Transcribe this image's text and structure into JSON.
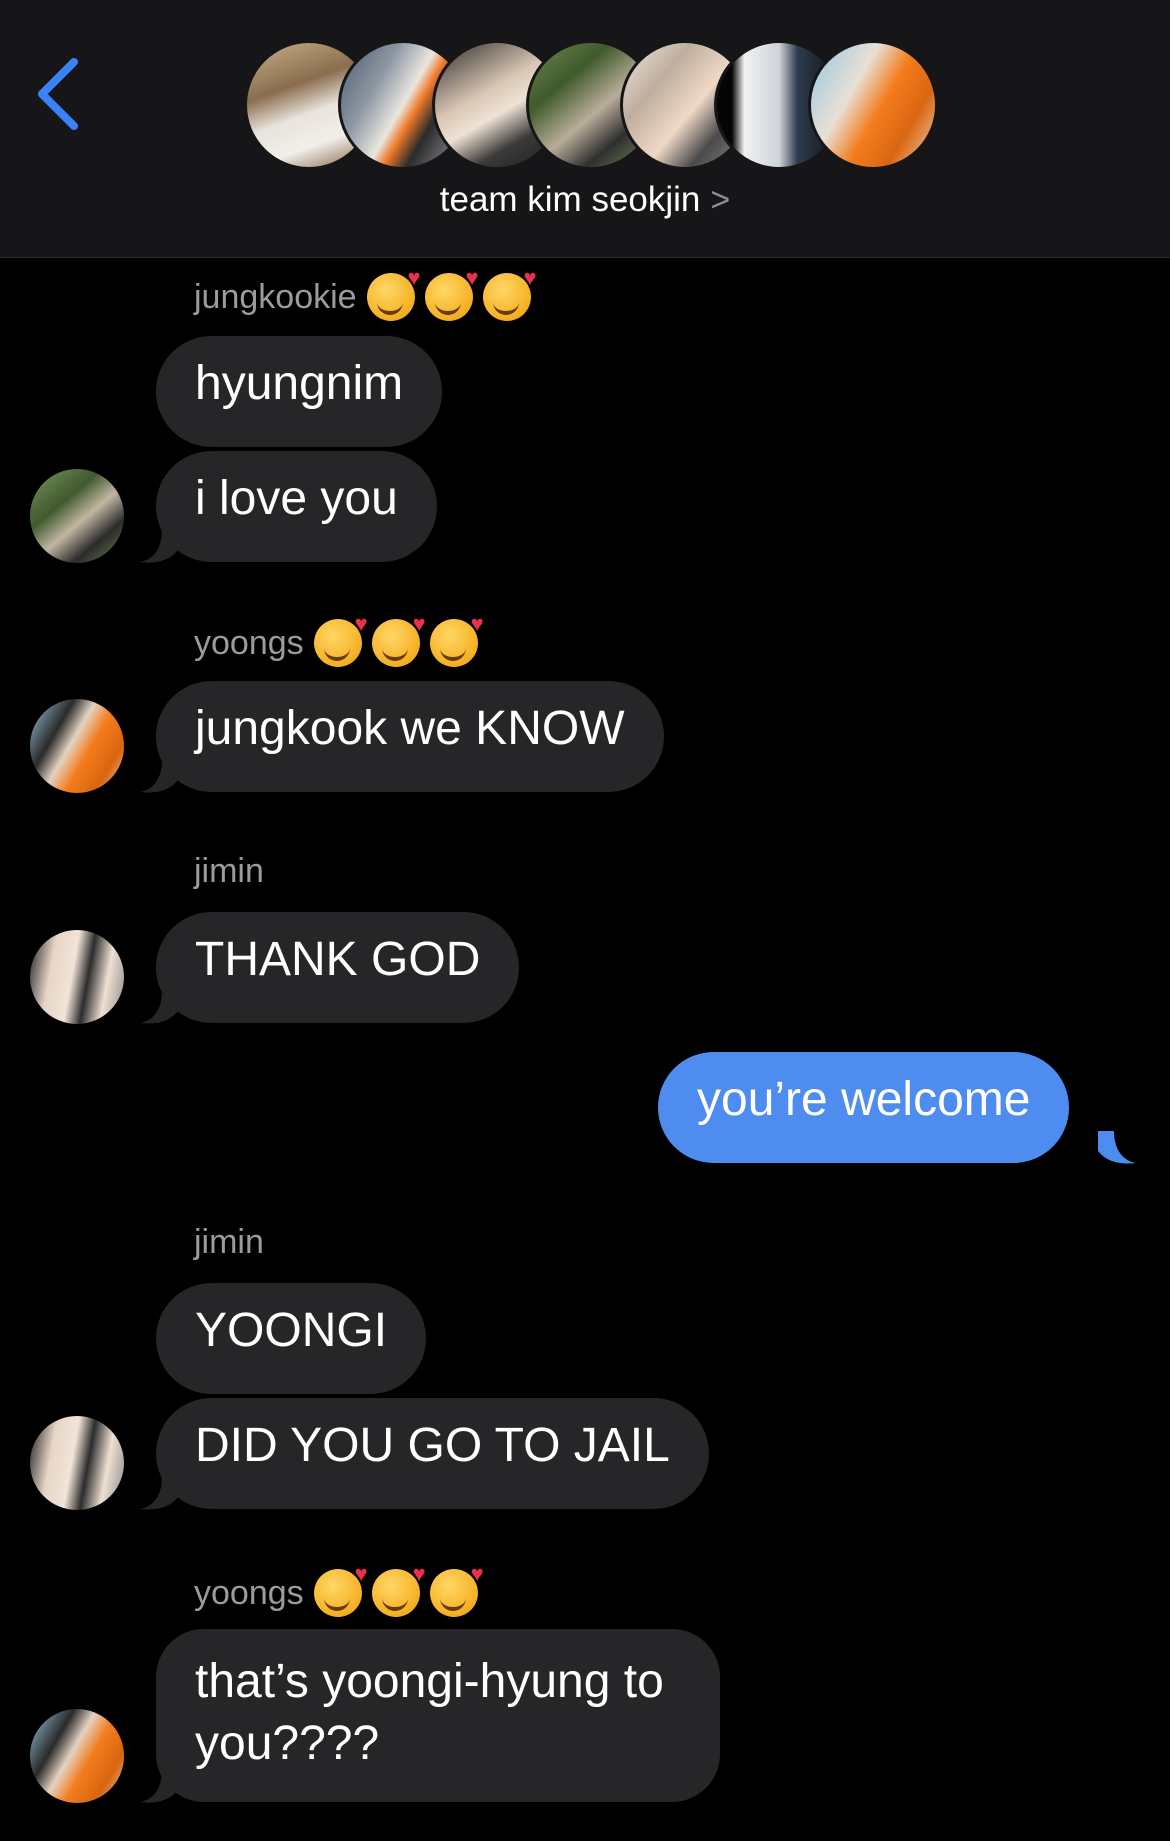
{
  "header": {
    "title": "team kim seokjin",
    "chevron": ">",
    "back_icon": "chevron-left-icon",
    "accent": "#3a82f7"
  },
  "messages": [
    {
      "sender": "jungkookie",
      "sender_emoji_count": 3,
      "text": "hyungnim"
    },
    {
      "text": "i love you"
    },
    {
      "sender": "yoongs",
      "sender_emoji_count": 3,
      "text": "jungkook we KNOW"
    },
    {
      "sender": "jimin",
      "text": "THANK GOD"
    },
    {
      "text": "you’re welcome",
      "outgoing": true
    },
    {
      "sender": "jimin",
      "text": "YOONGI"
    },
    {
      "text": "DID YOU GO TO JAIL"
    },
    {
      "sender": "yoongs",
      "sender_emoji_count": 3,
      "text": "that’s yoongi-hyung to you????"
    }
  ],
  "colors": {
    "incoming_bubble": "#262628",
    "outgoing_bubble": "#4f8cf0",
    "sender_text": "#9a9a9f"
  }
}
